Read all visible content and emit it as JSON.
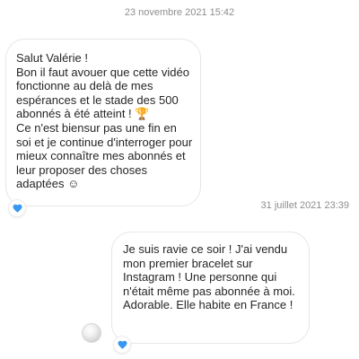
{
  "thread": {
    "timestamp_1": "23 novembre 2021 15:42",
    "timestamp_2": "31 juillet 2021 23:39",
    "message_1": "Salut Valérie !\nBon il faut avouer que cette vidéo fonctionne au delà de mes espérances et le stade des 500 abonnés à été atteint ! 🏆\nCe n'est biensur pas une fin en soi et je continue d'interroger pour mieux connaître mes abonnés et leur proposer des choses adaptées ☺",
    "message_2": "Je suis ravie ce soir ! J'ai vendu mon premier bracelet sur Instagram ! Une personne qui n'était même pas abonnée à moi. Adorable. Elle habite en France !"
  },
  "colors": {
    "heart": "#3897f0",
    "timestamp": "#8e8e8e",
    "bubble_border": "#e6e6e6"
  },
  "icons": {
    "reaction": "heart-icon",
    "sender_avatar": "avatar"
  }
}
